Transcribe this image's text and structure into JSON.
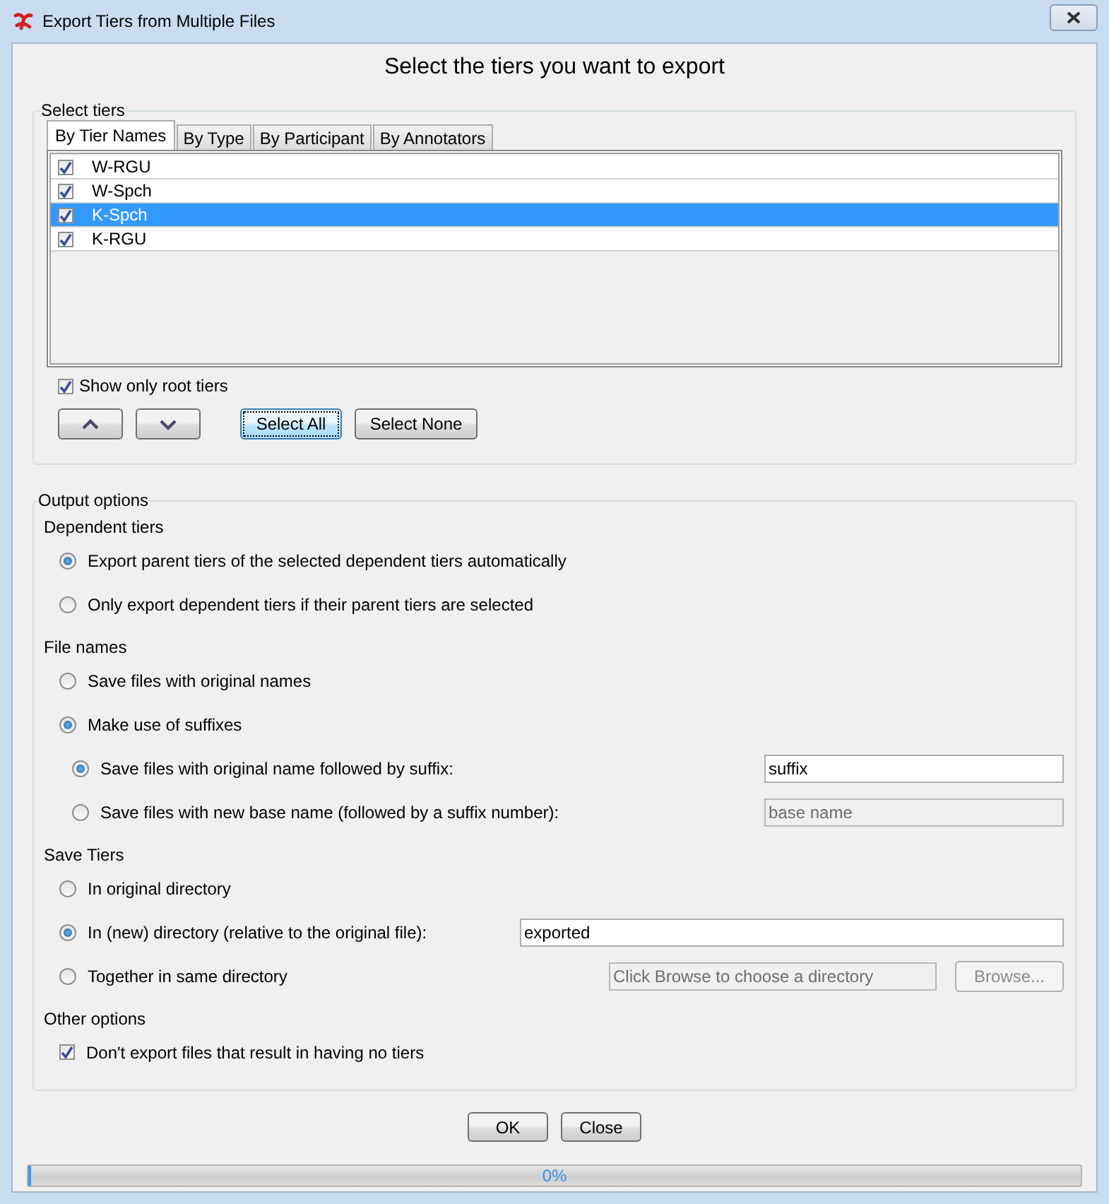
{
  "window": {
    "title": "Export Tiers from Multiple Files"
  },
  "heading": "Select the tiers you want to export",
  "select_tiers": {
    "label": "Select tiers",
    "tabs": [
      {
        "label": "By Tier Names",
        "selected": true
      },
      {
        "label": "By Type",
        "selected": false
      },
      {
        "label": "By Participant",
        "selected": false
      },
      {
        "label": "By Annotators",
        "selected": false
      }
    ],
    "tiers": [
      {
        "name": "W-RGU",
        "checked": true,
        "selected": false
      },
      {
        "name": "W-Spch",
        "checked": true,
        "selected": false
      },
      {
        "name": "K-Spch",
        "checked": true,
        "selected": true
      },
      {
        "name": "K-RGU",
        "checked": true,
        "selected": false
      }
    ],
    "root_only": {
      "label": "Show only root tiers",
      "checked": true
    },
    "buttons": [
      {
        "kind": "up"
      },
      {
        "kind": "down"
      },
      {
        "kind": "text",
        "label": "Select All",
        "focused": true
      },
      {
        "kind": "text",
        "label": "Select None",
        "focused": false
      }
    ]
  },
  "output_options": {
    "label": "Output options",
    "sections": [
      {
        "title": "Dependent tiers",
        "options": [
          {
            "kind": "radio",
            "label": "Export parent tiers of the selected dependent tiers automatically",
            "selected": true
          },
          {
            "kind": "radio",
            "label": "Only export dependent tiers if their parent tiers are selected",
            "selected": false
          }
        ]
      },
      {
        "title": "File names",
        "options": [
          {
            "kind": "radio",
            "label": "Save files with original names",
            "selected": false
          },
          {
            "kind": "radio",
            "label": "Make use of suffixes",
            "selected": true,
            "children": [
              {
                "kind": "radio",
                "label": "Save files with original name followed by suffix:",
                "selected": true,
                "field": {
                  "value": "suffix",
                  "disabled": false
                }
              },
              {
                "kind": "radio",
                "label": "Save files with new base name (followed by a suffix number):",
                "selected": false,
                "field": {
                  "value": "base name",
                  "disabled": true
                }
              }
            ]
          }
        ]
      },
      {
        "title": "Save Tiers",
        "options": [
          {
            "kind": "radio",
            "label": "In original directory",
            "selected": false
          },
          {
            "kind": "radio",
            "label": "In (new) directory (relative to the original file):",
            "selected": true,
            "field": {
              "value": "exported",
              "disabled": false
            }
          },
          {
            "kind": "radio",
            "label": "Together in same directory",
            "selected": false,
            "field": {
              "value": "Click Browse to choose a directory",
              "disabled": true
            },
            "button": {
              "label": "Browse...",
              "disabled": true
            }
          }
        ]
      },
      {
        "title": "Other options",
        "options": [
          {
            "kind": "checkbox",
            "label": "Don't export files that result in having no tiers",
            "checked": true
          }
        ]
      }
    ]
  },
  "buttons": [
    {
      "label": "OK"
    },
    {
      "label": "Close"
    }
  ],
  "progress": {
    "level": 0,
    "text": "0%"
  }
}
